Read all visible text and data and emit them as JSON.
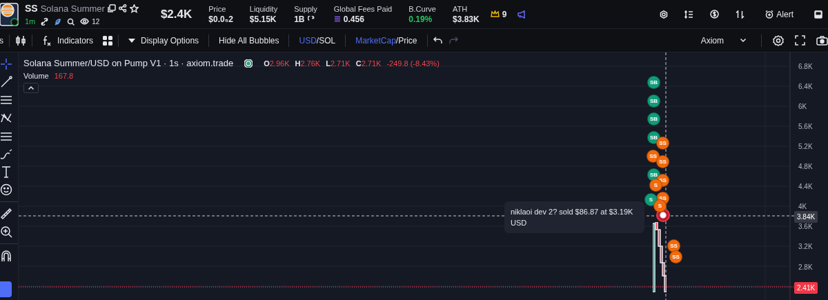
{
  "header": {
    "ticker": "SS",
    "name": "Solana Summer",
    "age": "1m",
    "watchers": "12",
    "market_cap": "$2.4K",
    "stats": [
      {
        "label": "Price",
        "value": "$0.0₅2",
        "kind": "plain"
      },
      {
        "label": "Liquidity",
        "value": "$5.15K",
        "kind": "plain"
      },
      {
        "label": "Supply",
        "value": "1B",
        "kind": "supply"
      },
      {
        "label": "Global Fees Paid",
        "value": "0.456",
        "kind": "fees"
      },
      {
        "label": "B.Curve",
        "value": "0.19%",
        "kind": "positive"
      },
      {
        "label": "ATH",
        "value": "$3.83K",
        "kind": "plain"
      }
    ],
    "crown_count": "9",
    "alert": "Alert"
  },
  "toolbar": {
    "cut_label": "s",
    "indicators": "Indicators",
    "display_options": "Display Options",
    "hide_bubbles": "Hide All Bubbles",
    "toggles": [
      {
        "separator": "/",
        "options": [
          {
            "label": "USD",
            "selected": true
          },
          {
            "label": "SOL",
            "selected": false
          }
        ]
      },
      {
        "separator": "/",
        "options": [
          {
            "label": "MarketCap",
            "selected": true
          },
          {
            "label": "Price",
            "selected": false
          }
        ]
      }
    ],
    "source": "Axiom"
  },
  "legend": {
    "title": "Solana Summer/USD on Pump V1 · 1s · axiom.trade",
    "ohlc": [
      {
        "key": "O",
        "value": "2.96K"
      },
      {
        "key": "H",
        "value": "2.76K"
      },
      {
        "key": "L",
        "value": "2.71K"
      },
      {
        "key": "C",
        "value": "2.71K"
      }
    ],
    "change": "-249.8 (-8.43%)",
    "volume_label": "Volume",
    "volume": "167.8"
  },
  "price_axis": [
    "6.8K",
    "6.4K",
    "6K",
    "5.6K",
    "5.2K",
    "4.8K",
    "4.4K",
    "4K",
    "3.6K",
    "3.2K",
    "2.8K"
  ],
  "crosshair_price": "3.84K",
  "last_price": "2.41K",
  "bubbles": [
    {
      "label": "SB",
      "kind": "buy"
    },
    {
      "label": "SB",
      "kind": "buy"
    },
    {
      "label": "SB",
      "kind": "buy"
    },
    {
      "label": "SB",
      "kind": "buy"
    },
    {
      "label": "SS",
      "kind": "sell"
    },
    {
      "label": "SS",
      "kind": "sell"
    },
    {
      "label": "SS",
      "kind": "sell"
    },
    {
      "label": "SB",
      "kind": "buy"
    },
    {
      "label": "SS",
      "kind": "sell"
    },
    {
      "label": "S",
      "kind": "sell"
    },
    {
      "label": "SS",
      "kind": "sell"
    },
    {
      "label": "S",
      "kind": "buy"
    },
    {
      "label": "S",
      "kind": "sell"
    },
    {
      "label": "SS",
      "kind": "sell"
    },
    {
      "label": "SS",
      "kind": "sell"
    }
  ],
  "tooltip": "niklaoi dev 2? sold $86.87 at $3.19K USD"
}
